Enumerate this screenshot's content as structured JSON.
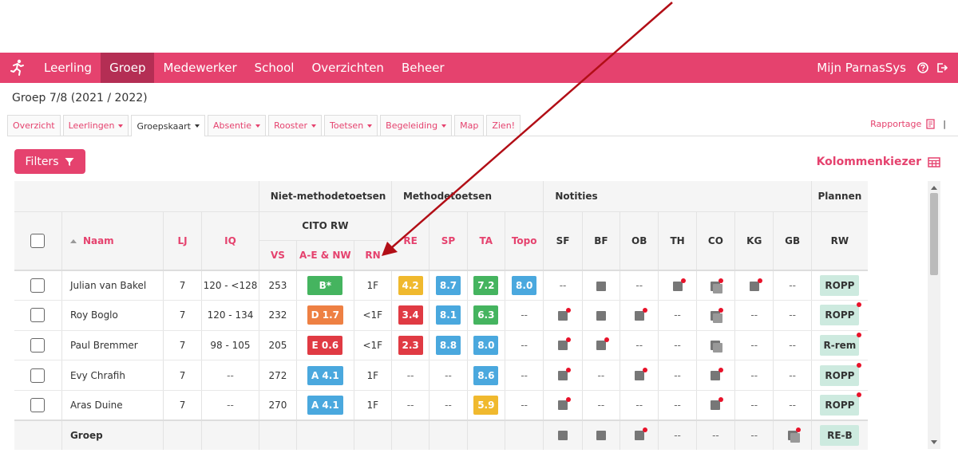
{
  "nav": {
    "items": [
      "Leerling",
      "Groep",
      "Medewerker",
      "School",
      "Overzichten",
      "Beheer"
    ],
    "active_index": 1,
    "user_label": "Mijn ParnasSys"
  },
  "group_title": "Groep 7/8 (2021 / 2022)",
  "tabs": {
    "items": [
      {
        "label": "Overzicht",
        "dropdown": false
      },
      {
        "label": "Leerlingen",
        "dropdown": true
      },
      {
        "label": "Groepskaart",
        "dropdown": true
      },
      {
        "label": "Absentie",
        "dropdown": true
      },
      {
        "label": "Rooster",
        "dropdown": true
      },
      {
        "label": "Toetsen",
        "dropdown": true
      },
      {
        "label": "Begeleiding",
        "dropdown": true
      },
      {
        "label": "Map",
        "dropdown": false
      },
      {
        "label": "Zien!",
        "dropdown": false
      }
    ],
    "active_index": 2,
    "rapportage_label": "Rapportage"
  },
  "toolbar": {
    "filters_label": "Filters",
    "kolommenkiezer_label": "Kolommenkiezer"
  },
  "table": {
    "groups": {
      "niet_methode": "Niet-methodetoetsen",
      "methode": "Methodetoetsen",
      "notities": "Notities",
      "plannen": "Plannen"
    },
    "subgroup_cito": "CITO RW",
    "columns": {
      "naam": "Naam",
      "lj": "LJ",
      "iq": "IQ",
      "vs": "VS",
      "ae": "A-E & NW",
      "rn": "RN",
      "re": "RE",
      "sp": "SP",
      "ta": "TA",
      "topo": "Topo",
      "sf": "SF",
      "bf": "BF",
      "ob": "OB",
      "th": "TH",
      "co": "CO",
      "kg": "KG",
      "gb": "GB",
      "rw": "RW"
    },
    "rows": [
      {
        "naam": "Julian van Bakel",
        "lj": "7",
        "iq": "120 - <128",
        "vs": "253",
        "ae": "B*",
        "rn": "1F",
        "re": "4.2",
        "sp": "8.7",
        "ta": "7.2",
        "topo": "8.0",
        "notes": {
          "sf": "--",
          "bf": "note",
          "ob": "--",
          "th": "note-dot",
          "co": "stack-dot",
          "kg": "note-dot",
          "gb": "--"
        },
        "rw": "ROPP",
        "rw_dot": false
      },
      {
        "naam": "Roy Boglo",
        "lj": "7",
        "iq": "120 - 134",
        "vs": "232",
        "ae": "D 1.7",
        "rn": "<1F",
        "re": "3.4",
        "sp": "8.1",
        "ta": "6.3",
        "topo": "--",
        "notes": {
          "sf": "note-dot",
          "bf": "note",
          "ob": "note-dot",
          "th": "--",
          "co": "stack-dot",
          "kg": "--",
          "gb": "--"
        },
        "rw": "ROPP",
        "rw_dot": true
      },
      {
        "naam": "Paul Bremmer",
        "lj": "7",
        "iq": "98 - 105",
        "vs": "205",
        "ae": "E 0.6",
        "rn": "<1F",
        "re": "2.3",
        "sp": "8.8",
        "ta": "8.0",
        "topo": "--",
        "notes": {
          "sf": "note-dot",
          "bf": "note-dot",
          "ob": "--",
          "th": "--",
          "co": "stack",
          "kg": "--",
          "gb": "--"
        },
        "rw": "R-rem",
        "rw_dot": true
      },
      {
        "naam": "Evy Chrafih",
        "lj": "7",
        "iq": "--",
        "vs": "272",
        "ae": "A 4.1",
        "rn": "1F",
        "re": "--",
        "sp": "--",
        "ta": "8.6",
        "topo": "--",
        "notes": {
          "sf": "note-dot",
          "bf": "--",
          "ob": "note-dot",
          "th": "--",
          "co": "note-dot",
          "kg": "--",
          "gb": "--"
        },
        "rw": "ROPP",
        "rw_dot": true
      },
      {
        "naam": "Aras Duine",
        "lj": "7",
        "iq": "--",
        "vs": "270",
        "ae": "A 4.1",
        "rn": "1F",
        "re": "--",
        "sp": "--",
        "ta": "5.9",
        "topo": "--",
        "notes": {
          "sf": "note-dot",
          "bf": "--",
          "ob": "--",
          "th": "--",
          "co": "note-dot",
          "kg": "--",
          "gb": "--"
        },
        "rw": "ROPP",
        "rw_dot": true
      }
    ],
    "footer": {
      "naam": "Groep",
      "notes": {
        "sf": "note",
        "bf": "note",
        "ob": "note-dot",
        "th": "--",
        "co": "--",
        "kg": "--",
        "gb": "stack-dot"
      },
      "rw": "RE-B"
    },
    "dash": "--"
  },
  "colors": {
    "brand": "#e5426e",
    "brand_dark": "#b42e54",
    "blue": "#4aa8de",
    "green": "#45b45f",
    "orange": "#ee8043",
    "red": "#e03a43",
    "yellow": "#f0b92e",
    "plan_bg": "#cdeadf",
    "note_dot": "#e8122a",
    "annotation_arrow": "#b20e16"
  },
  "badge_colors": {
    "ae": [
      "green",
      "orange",
      "red",
      "blue",
      "blue"
    ],
    "re": [
      "yellow",
      "red",
      "red",
      null,
      null
    ],
    "sp": [
      "blue",
      "blue",
      "blue",
      null,
      null
    ],
    "ta": [
      "green",
      "green",
      "blue",
      "blue",
      "yellow"
    ],
    "topo": [
      "blue",
      null,
      null,
      null,
      null
    ]
  },
  "icons": {
    "logo": "runner-logo-icon",
    "help": "help-circle-icon",
    "logout": "logout-icon",
    "filter": "funnel-icon",
    "columns": "grid-columns-icon",
    "rapportage": "document-icon"
  }
}
